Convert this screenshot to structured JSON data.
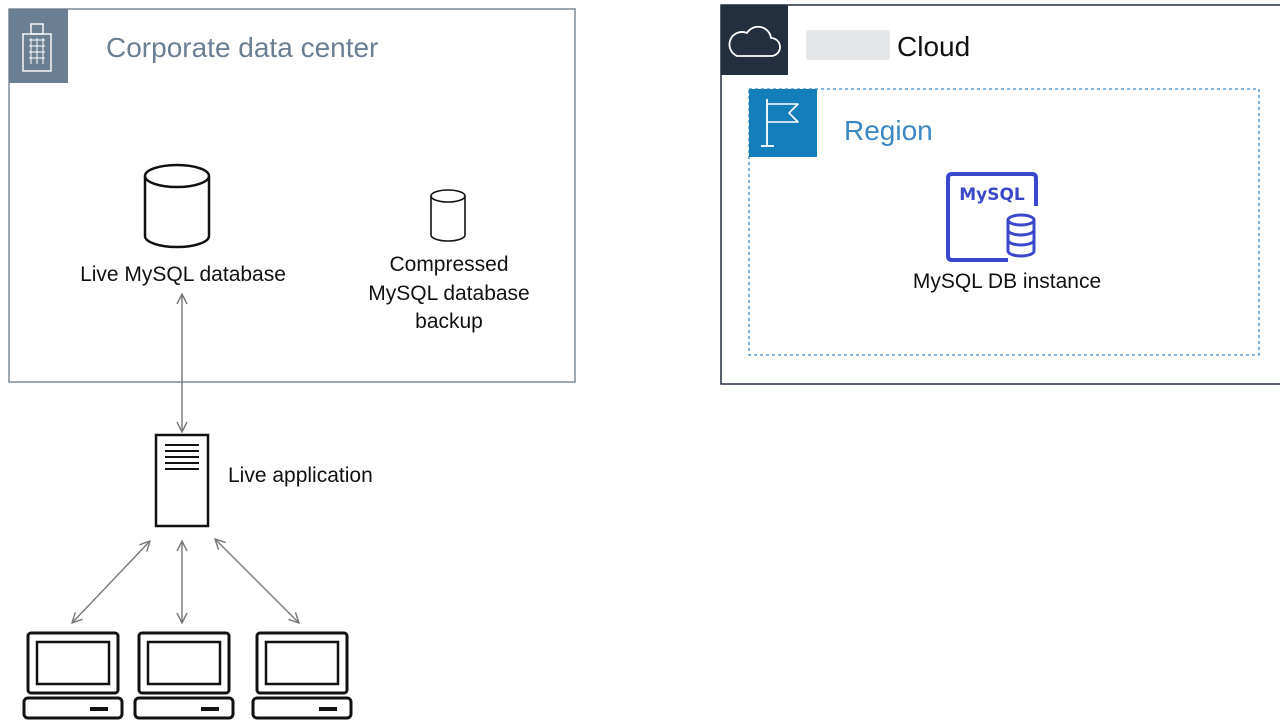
{
  "corporate": {
    "title": "Corporate data center",
    "live_db_label": "Live MySQL  database",
    "backup_label": [
      "Compressed",
      "MySQL  database",
      "backup"
    ]
  },
  "application": {
    "label": "Live application"
  },
  "cloud": {
    "title": "Cloud",
    "region_title": "Region",
    "mysql_badge": "MySQL",
    "db_instance_label": "MySQL  DB instance"
  },
  "colors": {
    "corporate_border": "#7b8a99",
    "corporate_header": "#6b7f93",
    "cloud_border": "#232f3e",
    "cloud_header": "#232f3e",
    "region_color": "#147eba",
    "mysql_purple": "#3b48cc",
    "arrow": "#777777"
  },
  "icons": {
    "corporate_header": "building-icon",
    "cloud_header": "cloud-icon",
    "region_header": "flag-icon",
    "live_db": "database-cylinder-icon",
    "backup_db": "database-cylinder-icon",
    "application": "server-icon",
    "clients": "laptop-icon",
    "mysql_instance": "mysql-db-instance-icon"
  }
}
